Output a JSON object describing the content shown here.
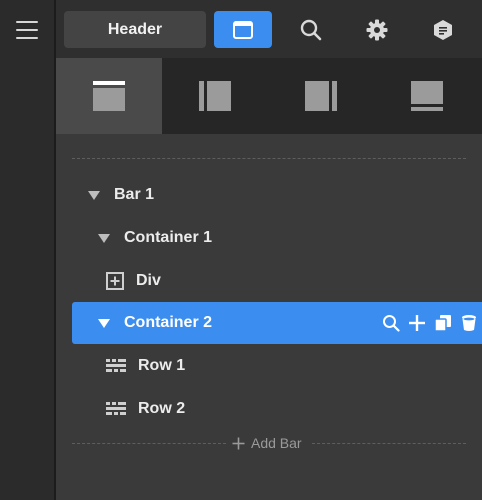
{
  "toolbar": {
    "header_label": "Header"
  },
  "tree": {
    "bar1": "Bar 1",
    "container1": "Container 1",
    "div": "Div",
    "container2": "Container 2",
    "row1": "Row 1",
    "row2": "Row 2"
  },
  "add_bar_label": "Add Bar",
  "colors": {
    "accent": "#3b8ef0",
    "rail": "#2b2b2b",
    "panel": "#3a3a3a"
  }
}
